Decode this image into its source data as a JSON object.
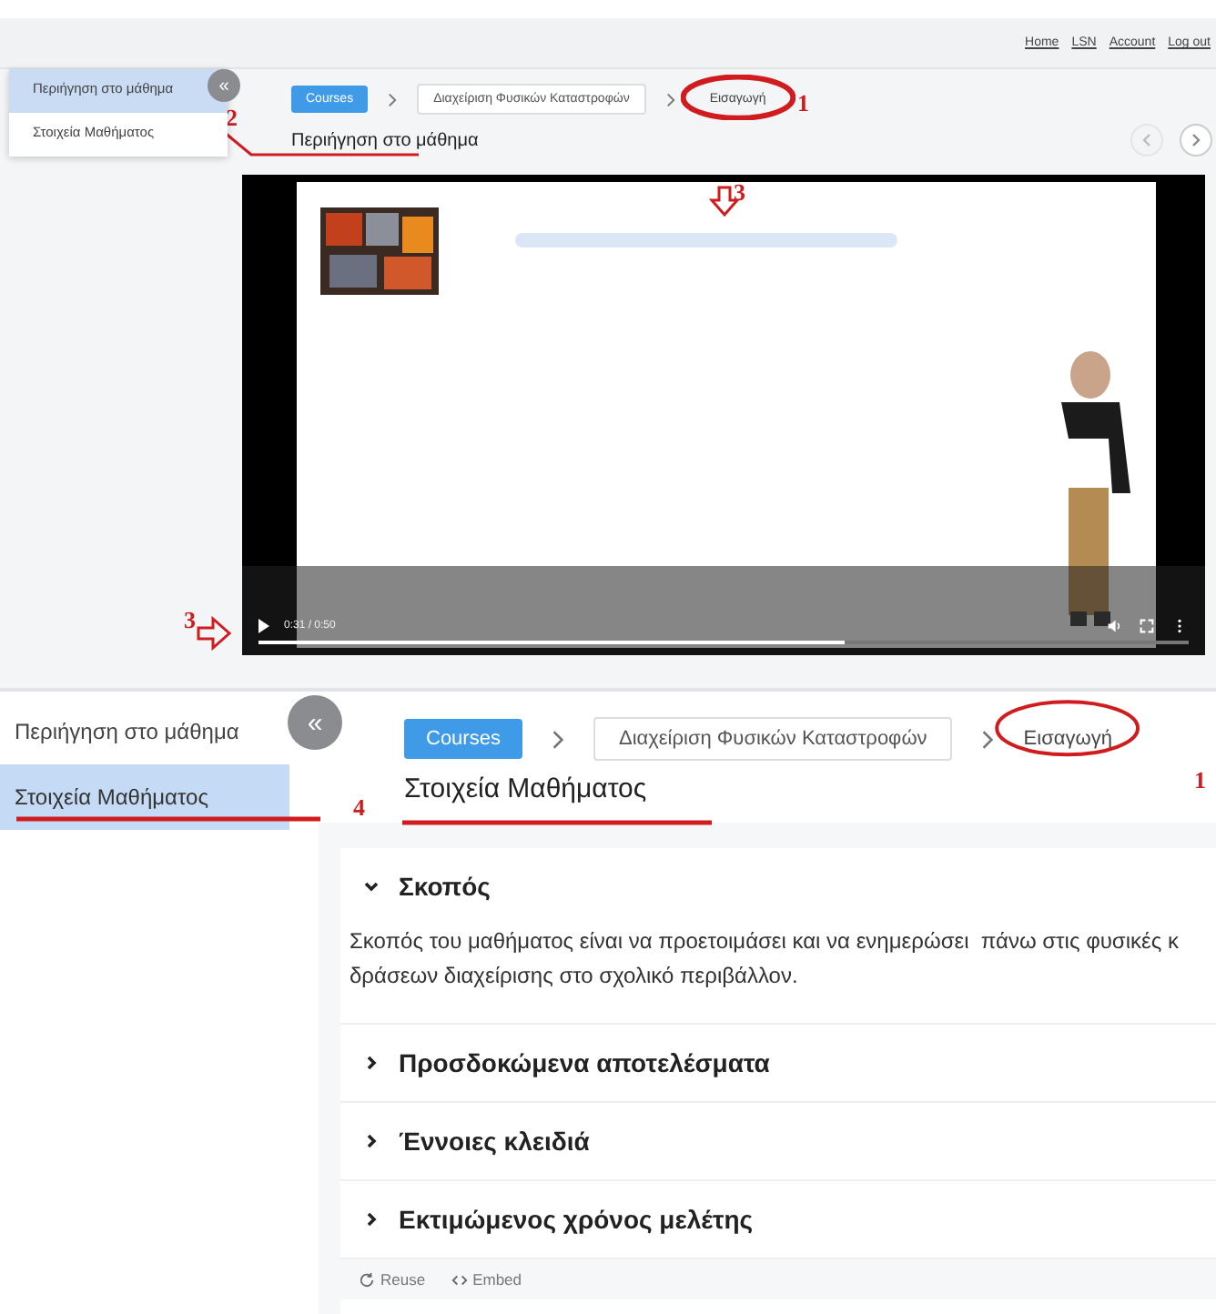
{
  "top_nav": {
    "links": [
      "Home",
      "LSN",
      "Account",
      "Log out"
    ]
  },
  "overview": {
    "collapse_label": "«",
    "sidebar": [
      {
        "label": "Περιήγηση στο μάθημα",
        "selected": true
      },
      {
        "label": "Στοιχεία Μαθήματος",
        "selected": false
      }
    ],
    "breadcrumb": [
      {
        "label": "Courses",
        "kind": "primary"
      },
      {
        "label": "Διαχείριση Φυσικών Καταστροφών",
        "kind": "outlined"
      },
      {
        "label": "Εισαγωγή",
        "kind": "plain"
      }
    ],
    "title": "Περιήγηση στο μάθημα",
    "video": {
      "kind": "picture",
      "time": "0:31 / 0:50",
      "level": 0.63
    }
  },
  "details": {
    "collapse_label": "«",
    "sidebar": [
      {
        "label": "Περιήγηση στο μάθημα",
        "selected": false
      },
      {
        "label": "Στοιχεία Μαθήματος",
        "selected": true
      }
    ],
    "breadcrumb": [
      {
        "label": "Courses",
        "kind": "primary"
      },
      {
        "label": "Διαχείριση Φυσικών Καταστροφών",
        "kind": "outlined"
      },
      {
        "label": "Εισαγωγή",
        "kind": "plain"
      }
    ],
    "title": "Στοιχεία Μαθήματος",
    "sections": [
      {
        "title": "Σκοπός",
        "expanded": true,
        "body": "Σκοπός του μαθήματος είναι να προετοιμάσει και να ενημερώσει  πάνω στις φυσικές κ\nδράσεων διαχείρισης στο σχολικό περιβάλλον."
      },
      {
        "title": "Προσδοκώμενα αποτελέσματα",
        "expanded": false
      },
      {
        "title": "Έννοιες κλειδιά",
        "expanded": false
      },
      {
        "title": "Εκτιμώμενος χρόνος μελέτης",
        "expanded": false
      }
    ],
    "footer_actions": [
      {
        "label": "Reuse",
        "kind": "reuse"
      },
      {
        "label": "Embed",
        "kind": "embed"
      }
    ]
  },
  "annotations": [
    {
      "label": "1"
    },
    {
      "label": "2"
    },
    {
      "label": "3"
    },
    {
      "label": "3"
    },
    {
      "label": "1"
    },
    {
      "label": "4"
    }
  ]
}
